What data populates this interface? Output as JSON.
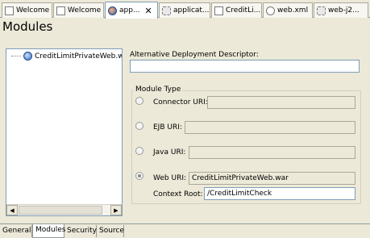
{
  "tabs": [
    {
      "label": "Welcome",
      "icon": "document-icon"
    },
    {
      "label": "Welcome",
      "icon": "document-icon"
    },
    {
      "label": "app...",
      "icon": "application-icon",
      "active": true
    },
    {
      "label": "applicat...",
      "icon": "gear-icon"
    },
    {
      "label": "CreditLi...",
      "icon": "document-icon"
    },
    {
      "label": "web.xml",
      "icon": "xml-icon"
    },
    {
      "label": "web-j2...",
      "icon": "gear-icon"
    }
  ],
  "close_glyph": "✕",
  "page_title": "Modules",
  "tree": {
    "items": [
      {
        "label": "CreditLimitPrivateWeb.war",
        "icon": "web-module-icon"
      }
    ],
    "scroll_left": "◀",
    "scroll_right": "▶"
  },
  "alt_descriptor": {
    "label": "Alternative Deployment Descriptor:",
    "value": ""
  },
  "module_type": {
    "title": "Module Type",
    "connector": {
      "label": "Connector URI:",
      "value": "",
      "selected": false
    },
    "ejb": {
      "label": "EJB URI:",
      "value": "",
      "selected": false
    },
    "java": {
      "label": "Java URI:",
      "value": "",
      "selected": false
    },
    "web": {
      "label": "Web URI:",
      "value": "CreditLimitPrivateWeb.war",
      "selected": true
    },
    "context_root": {
      "label": "Context Root:",
      "value": "/CreditLimitCheck"
    }
  },
  "page_tabs": [
    {
      "label": "General"
    },
    {
      "label": "Modules",
      "active": true
    },
    {
      "label": "Security"
    },
    {
      "label": "Source"
    }
  ]
}
